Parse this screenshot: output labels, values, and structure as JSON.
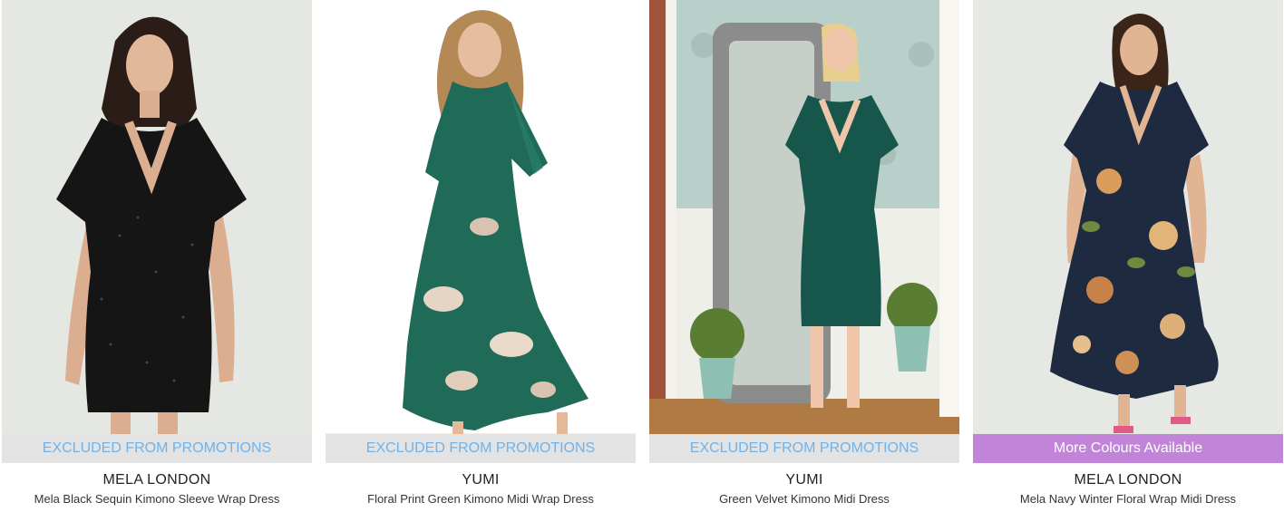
{
  "products": [
    {
      "badge": "EXCLUDED FROM PROMOTIONS",
      "brand": "MELA LONDON",
      "name": "Mela Black Sequin Kimono Sleeve Wrap Dress"
    },
    {
      "badge": "EXCLUDED FROM PROMOTIONS",
      "brand": "YUMI",
      "name": "Floral Print Green Kimono Midi Wrap Dress"
    },
    {
      "badge": "EXCLUDED FROM PROMOTIONS",
      "brand": "YUMI",
      "name": "Green Velvet Kimono Midi Dress"
    },
    {
      "badge": "More Colours Available",
      "brand": "MELA LONDON",
      "name": "Mela Navy Winter Floral Wrap Midi Dress"
    }
  ],
  "colors": {
    "badge_grey_bg": "#e3e3e3",
    "badge_grey_text": "#6fb3ea",
    "badge_purple_bg": "#c184d9",
    "badge_purple_text": "#ffffff"
  }
}
